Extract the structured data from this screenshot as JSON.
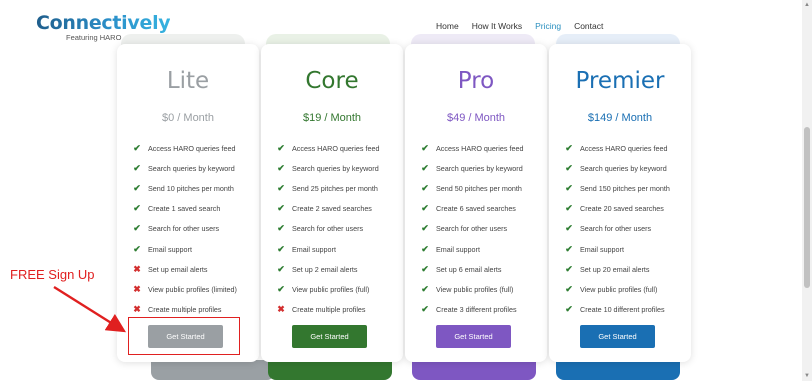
{
  "brand": {
    "name": "Connectively",
    "tagline": "Featuring HARO"
  },
  "nav": [
    "Home",
    "How It Works",
    "Pricing",
    "Contact"
  ],
  "nav_active": "Pricing",
  "colors": {
    "lite": "#9a9fa3",
    "core": "#33772f",
    "pro": "#7e57c2",
    "premier": "#1a6fb3",
    "lite_tab": "#eef0ee",
    "core_tab": "#e9f1e6",
    "pro_tab": "#eeeaf6",
    "premier_tab": "#e6eef8",
    "lite_bottom": "#9aa0a4",
    "core_bottom": "#33772f",
    "pro_bottom": "#7e57c2",
    "premier_bottom": "#1a6fb3",
    "check": "#2e7d32",
    "cross": "#d32f2f",
    "annotation": "#e02020"
  },
  "plans": [
    {
      "name": "Lite",
      "price": "$0 / Month",
      "button": "Get Started",
      "features": [
        {
          "text": "Access HARO queries feed",
          "included": true
        },
        {
          "text": "Search queries by keyword",
          "included": true
        },
        {
          "text": "Send 10 pitches per month",
          "included": true
        },
        {
          "text": "Create 1 saved search",
          "included": true
        },
        {
          "text": "Search for other users",
          "included": true
        },
        {
          "text": "Email support",
          "included": true
        },
        {
          "text": "Set up email alerts",
          "included": false
        },
        {
          "text": "View public profiles (limited)",
          "included": false
        },
        {
          "text": "Create multiple profiles",
          "included": false
        }
      ]
    },
    {
      "name": "Core",
      "price": "$19 / Month",
      "button": "Get Started",
      "features": [
        {
          "text": "Access HARO queries feed",
          "included": true
        },
        {
          "text": "Search queries by keyword",
          "included": true
        },
        {
          "text": "Send 25 pitches per month",
          "included": true
        },
        {
          "text": "Create 2 saved searches",
          "included": true
        },
        {
          "text": "Search for other users",
          "included": true
        },
        {
          "text": "Email support",
          "included": true
        },
        {
          "text": "Set up 2 email alerts",
          "included": true
        },
        {
          "text": "View public profiles (full)",
          "included": true
        },
        {
          "text": "Create multiple profiles",
          "included": false
        }
      ]
    },
    {
      "name": "Pro",
      "price": "$49 / Month",
      "button": "Get Started",
      "features": [
        {
          "text": "Access HARO queries feed",
          "included": true
        },
        {
          "text": "Search queries by keyword",
          "included": true
        },
        {
          "text": "Send 50 pitches per month",
          "included": true
        },
        {
          "text": "Create 6 saved searches",
          "included": true
        },
        {
          "text": "Search for other users",
          "included": true
        },
        {
          "text": "Email support",
          "included": true
        },
        {
          "text": "Set up 6 email alerts",
          "included": true
        },
        {
          "text": "View public profiles (full)",
          "included": true
        },
        {
          "text": "Create 3 different profiles",
          "included": true
        }
      ]
    },
    {
      "name": "Premier",
      "price": "$149 / Month",
      "button": "Get Started",
      "features": [
        {
          "text": "Access HARO queries feed",
          "included": true
        },
        {
          "text": "Search queries by keyword",
          "included": true
        },
        {
          "text": "Send 150 pitches per month",
          "included": true
        },
        {
          "text": "Create 20 saved searches",
          "included": true
        },
        {
          "text": "Search for other users",
          "included": true
        },
        {
          "text": "Email support",
          "included": true
        },
        {
          "text": "Set up 20 email alerts",
          "included": true
        },
        {
          "text": "View public profiles (full)",
          "included": true
        },
        {
          "text": "Create 10 different profiles",
          "included": true
        }
      ]
    }
  ],
  "icons": {
    "included": "check-icon",
    "excluded": "cross-icon"
  },
  "annotation": {
    "label": "FREE Sign Up"
  }
}
